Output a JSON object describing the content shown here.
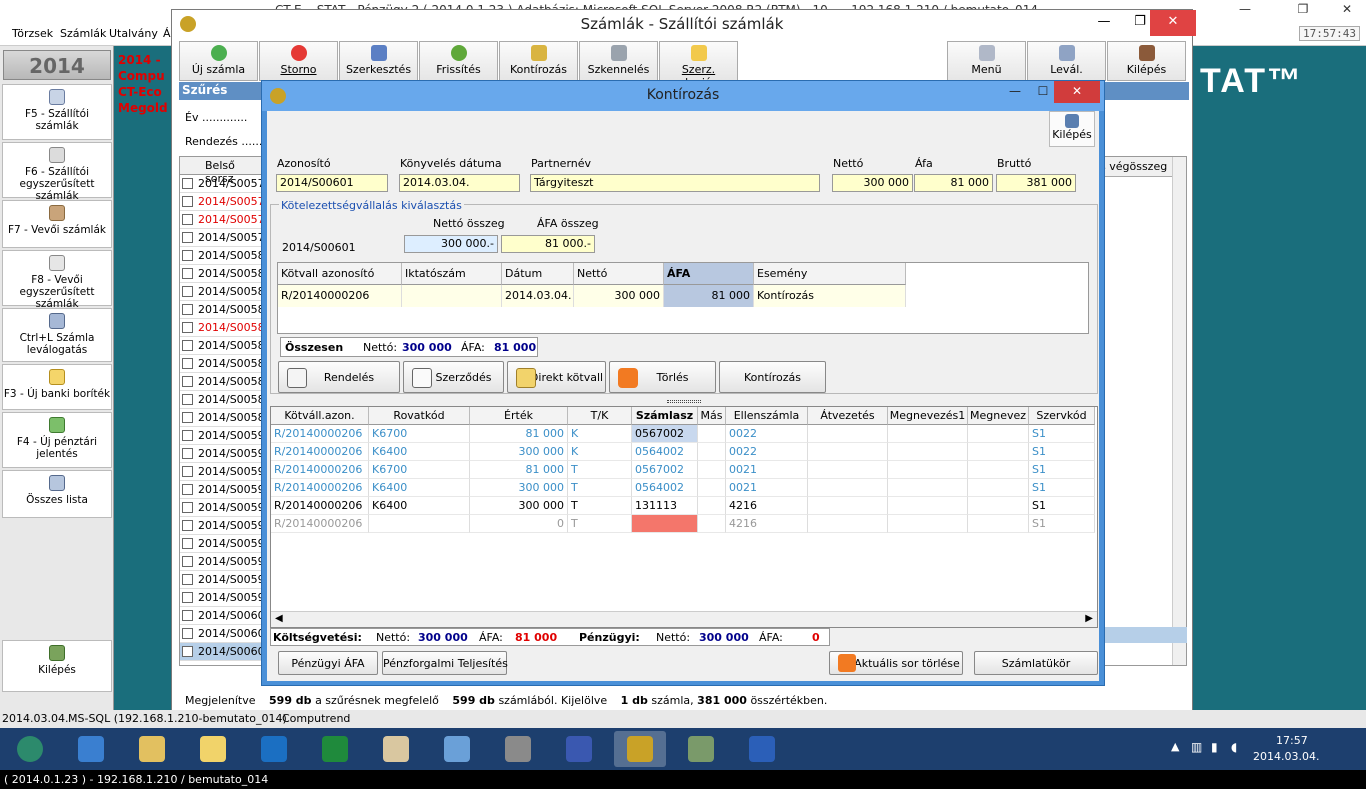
{
  "bg": {
    "title": "CT-E... STAT - Pénzügy 2 ( 2014.0.1.23 ) Adatbázis: Microsoft SQL Server 2008 R2 (RTM) - 10... - 192.168.1.210 / bemutato_014",
    "menu": [
      "Törzsek",
      "Számlák",
      "Utalvány",
      "Á"
    ],
    "clock": "17:57:43",
    "year": "2014",
    "red_lines": [
      "2014 -",
      "Compu",
      "CT-Eco",
      "Megold"
    ],
    "sidebar": [
      {
        "icon": "invoice-icon",
        "label": "F5 - Szállítói számlák"
      },
      {
        "icon": "simple-invoice-icon",
        "label": "F6 - Szállítói egyszerűsített számlák"
      },
      {
        "icon": "customer-invoice-icon",
        "label": "F7 - Vevői számlák"
      },
      {
        "icon": "simple-customer-invoice-icon",
        "label": "F8 - Vevői egyszerűsített számlák"
      },
      {
        "icon": "filter-icon",
        "label": "Ctrl+L Számla leválogatás"
      },
      {
        "icon": "envelope-icon",
        "label": "F3 - Új banki boríték"
      },
      {
        "icon": "cash-icon",
        "label": "F4 - Új pénztári jelentés"
      },
      {
        "icon": "list-icon",
        "label": "Összes lista"
      }
    ],
    "exit_label": "Kilépés",
    "list_header": "Belső sorsz",
    "list_rows": [
      {
        "v": "2014/S0057",
        "red": false
      },
      {
        "v": "2014/S0057",
        "red": true
      },
      {
        "v": "2014/S0057",
        "red": true
      },
      {
        "v": "2014/S0057",
        "red": false
      },
      {
        "v": "2014/S0058",
        "red": false
      },
      {
        "v": "2014/S0058",
        "red": false
      },
      {
        "v": "2014/S0058",
        "red": false
      },
      {
        "v": "2014/S0058",
        "red": false
      },
      {
        "v": "2014/S0058",
        "red": true
      },
      {
        "v": "2014/S0058",
        "red": false
      },
      {
        "v": "2014/S0058",
        "red": false
      },
      {
        "v": "2014/S0058",
        "red": false
      },
      {
        "v": "2014/S0058",
        "red": false
      },
      {
        "v": "2014/S0058",
        "red": false
      },
      {
        "v": "2014/S0059",
        "red": false
      },
      {
        "v": "2014/S0059",
        "red": false
      },
      {
        "v": "2014/S0059",
        "red": false
      },
      {
        "v": "2014/S0059",
        "red": false
      },
      {
        "v": "2014/S0059",
        "red": false
      },
      {
        "v": "2014/S0059",
        "red": false
      },
      {
        "v": "2014/S0059",
        "red": false
      },
      {
        "v": "2014/S0059",
        "red": false
      },
      {
        "v": "2014/S0059",
        "red": false
      },
      {
        "v": "2014/S0059",
        "red": false
      },
      {
        "v": "2014/S0060",
        "red": false
      },
      {
        "v": "2014/S0060",
        "red": false
      },
      {
        "v": "2014/S0060",
        "red": false
      }
    ],
    "right_col_header": "s végösszeg",
    "status": [
      "2014.03.04.",
      "MS-SQL (192.168.1.210-bemutato_014)",
      "Computrend"
    ],
    "brand": "TAT™"
  },
  "szamlak": {
    "title": "Számlák - Szállítói számlák",
    "toolbar": [
      {
        "label": "Új számla",
        "icon": "plus-icon"
      },
      {
        "label": "Storno",
        "icon": "cancel-icon"
      },
      {
        "label": "Szerkesztés",
        "icon": "edit-icon"
      },
      {
        "label": "Frissítés",
        "icon": "refresh-icon"
      },
      {
        "label": "Kontírozás",
        "icon": "posting-icon"
      },
      {
        "label": "Szkennelés",
        "icon": "scanner-icon"
      },
      {
        "label": "Szerz. alapján",
        "icon": "contract-icon"
      }
    ],
    "toolbar_right": [
      {
        "label": "Menü",
        "icon": "menu-icon"
      },
      {
        "label": "Levál.",
        "icon": "filter-icon"
      },
      {
        "label": "Kilépés",
        "icon": "exit-icon"
      }
    ],
    "filter_title": "Szűrés",
    "ev_label": "Év .............",
    "rend_label": "Rendezés .......",
    "status_parts": [
      "Megjelenítve",
      "599 db",
      "a szűrésnek megfelelő",
      "599 db",
      "számlából. Kijelölve",
      "1 db",
      "számla,",
      "381 000",
      "összértékben."
    ]
  },
  "kontir": {
    "title": "Kontírozás",
    "exit_label": "Kilépés",
    "header_labels": [
      "Azonosító",
      "Könyvelés dátuma",
      "Partnernév",
      "Nettó",
      "Áfa",
      "Bruttó"
    ],
    "header_values": [
      "2014/S00601",
      "2014.03.04.",
      "Tárgyiteszt",
      "300 000",
      "81 000",
      "381 000"
    ],
    "section_title": "Kötelezettségvállalás kiválasztás",
    "ko_id": "2014/S00601",
    "netto_label": "Nettó összeg",
    "afa_label": "ÁFA összeg",
    "netto_val": "300 000.-",
    "afa_val": "81 000.-",
    "ko_columns": [
      "Kötvall azonosító",
      "Iktatószám",
      "Dátum",
      "Nettó",
      "ÁFA",
      "Esemény"
    ],
    "ko_row": [
      "R/20140000206",
      "",
      "2014.03.04.",
      "300 000",
      "81 000",
      "Kontírozás"
    ],
    "sum_label": "Összesen",
    "sum_netto_label": "Nettó:",
    "sum_netto": "300 000",
    "sum_afa_label": "ÁFA:",
    "sum_afa": "81 000",
    "buttons": [
      {
        "label": "Rendelés",
        "icon": "order-icon"
      },
      {
        "label": "Szerződés",
        "icon": "contract-icon"
      },
      {
        "label": "Direkt kötvall",
        "icon": "pencil-icon"
      },
      {
        "label": "Törlés",
        "icon": "delete-x-icon"
      },
      {
        "label": "Kontírozás",
        "icon": ""
      }
    ],
    "grid_columns": [
      "Kötváll.azon.",
      "Rovatkód",
      "Érték",
      "T/K",
      "Számlasz",
      "Más",
      "Ellenszámla",
      "Átvezetés",
      "Megnevezés1",
      "Megnevez",
      "Szervkód"
    ],
    "grid_rows": [
      {
        "style": "blue",
        "cells": [
          "R/20140000206",
          "K6700",
          "81 000",
          "K",
          "0567002",
          "",
          "0022",
          "",
          "",
          "",
          "S1"
        ]
      },
      {
        "style": "blue",
        "cells": [
          "R/20140000206",
          "K6400",
          "300 000",
          "K",
          "0564002",
          "",
          "0022",
          "",
          "",
          "",
          "S1"
        ]
      },
      {
        "style": "blue",
        "cells": [
          "R/20140000206",
          "K6700",
          "81 000",
          "T",
          "0567002",
          "",
          "0021",
          "",
          "",
          "",
          "S1"
        ]
      },
      {
        "style": "blue",
        "cells": [
          "R/20140000206",
          "K6400",
          "300 000",
          "T",
          "0564002",
          "",
          "0021",
          "",
          "",
          "",
          "S1"
        ]
      },
      {
        "style": "black",
        "cells": [
          "R/20140000206",
          "K6400",
          "300 000",
          "T",
          "131113",
          "",
          "4216",
          "",
          "",
          "",
          "S1"
        ]
      },
      {
        "style": "gray",
        "cells": [
          "R/20140000206",
          "",
          "0",
          "T",
          "",
          "",
          "4216",
          "",
          "",
          "",
          "S1"
        ]
      }
    ],
    "budget_label": "Költségvetési:",
    "b_netto_label": "Nettó:",
    "b_netto": "300 000",
    "b_afa_label": "ÁFA:",
    "b_afa": "81 000",
    "fin_label": "Pénzügyi:",
    "f_netto_label": "Nettó:",
    "f_netto": "300 000",
    "f_afa_label": "ÁFA:",
    "f_afa": "0",
    "bottom_buttons": [
      "Pénzügyi ÁFA",
      "Pénzforgalmi Teljesítés",
      "Aktuális sor törlése",
      "Számlatükör"
    ]
  },
  "taskbar": {
    "apps": [
      "globe-icon",
      "ie-icon",
      "explorer-icon",
      "notes-icon",
      "outlook-icon",
      "excel-icon",
      "checklist-icon",
      "tools-icon",
      "safe-icon",
      "floppy-icon",
      "coins-icon",
      "books-icon",
      "word-icon"
    ],
    "time": "17:57",
    "date": "2014.03.04."
  },
  "footer": "( 2014.0.1.23 ) - 192.168.1.210 / bemutato_014",
  "colors": {
    "accent": "#4a90d8",
    "field_yellow": "#ffffcc",
    "link_blue": "#3b8fc8",
    "alert_red": "#e00000",
    "taskbar": "#1d3f6e"
  }
}
